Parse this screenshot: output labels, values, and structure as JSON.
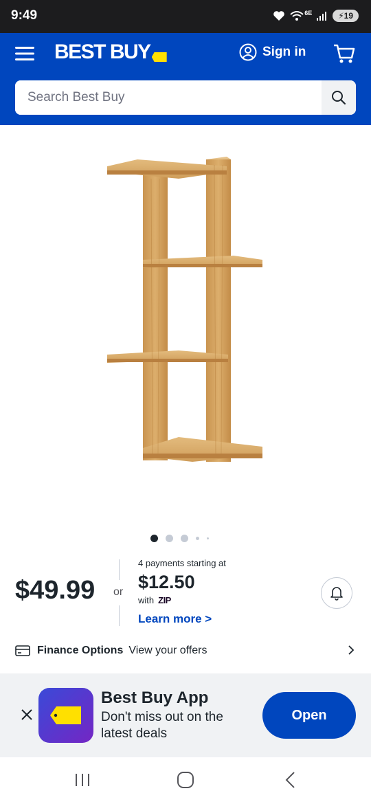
{
  "status_bar": {
    "time": "9:49",
    "network_label": "6E",
    "battery": "19"
  },
  "header": {
    "logo_text": "BEST BUY",
    "sign_in_label": "Sign in",
    "brand_color": "#0046be",
    "tag_color": "#ffe000"
  },
  "search": {
    "placeholder": "Search Best Buy"
  },
  "product": {
    "image_icon": "wood-shelf-image",
    "carousel_dots": 5,
    "carousel_active_index": 0
  },
  "pricing": {
    "price": "$49.99",
    "or_label": "or",
    "payments_line": "4 payments starting at",
    "payment_amount": "$12.50",
    "with_label": "with",
    "zip_label": "ZIP",
    "learn_more": "Learn more >"
  },
  "finance": {
    "title": "Finance Options",
    "offers": "View your offers"
  },
  "app_banner": {
    "title": "Best Buy App",
    "subtitle": "Don't miss out on the latest deals",
    "open_label": "Open"
  }
}
